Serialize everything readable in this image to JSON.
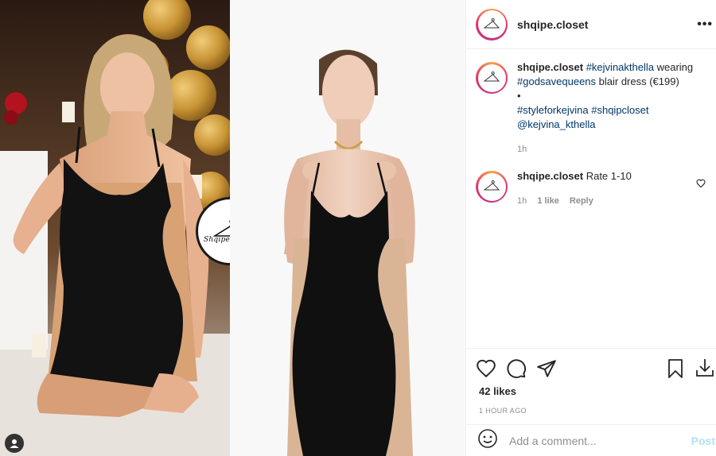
{
  "post": {
    "username": "shqipe.closet",
    "more_icon": "more-horizontal-icon",
    "brand_badge_text": "Shqipe Closet"
  },
  "caption": {
    "username": "shqipe.closet",
    "tag1": "#kejvinakthella",
    "text1": " wearing ",
    "tag2": "#godsavequeens",
    "text2": " blair dress (€199)",
    "bullet": "•",
    "tag3": "#styleforkejvina",
    "tag4": "#shqipcloset",
    "mention": "@kejvina_kthella",
    "time": "1h"
  },
  "comment": {
    "username": "shqipe.closet",
    "text": "Rate 1-10",
    "time": "1h",
    "likes": "1 like",
    "reply": "Reply"
  },
  "actions": {
    "likes": "42 likes",
    "time_ago": "1 HOUR AGO"
  },
  "add_comment": {
    "placeholder": "Add a comment...",
    "post_label": "Post"
  },
  "colors": {
    "link": "#00376b",
    "muted": "#8e8e8e",
    "post_disabled": "#b2dffc"
  }
}
